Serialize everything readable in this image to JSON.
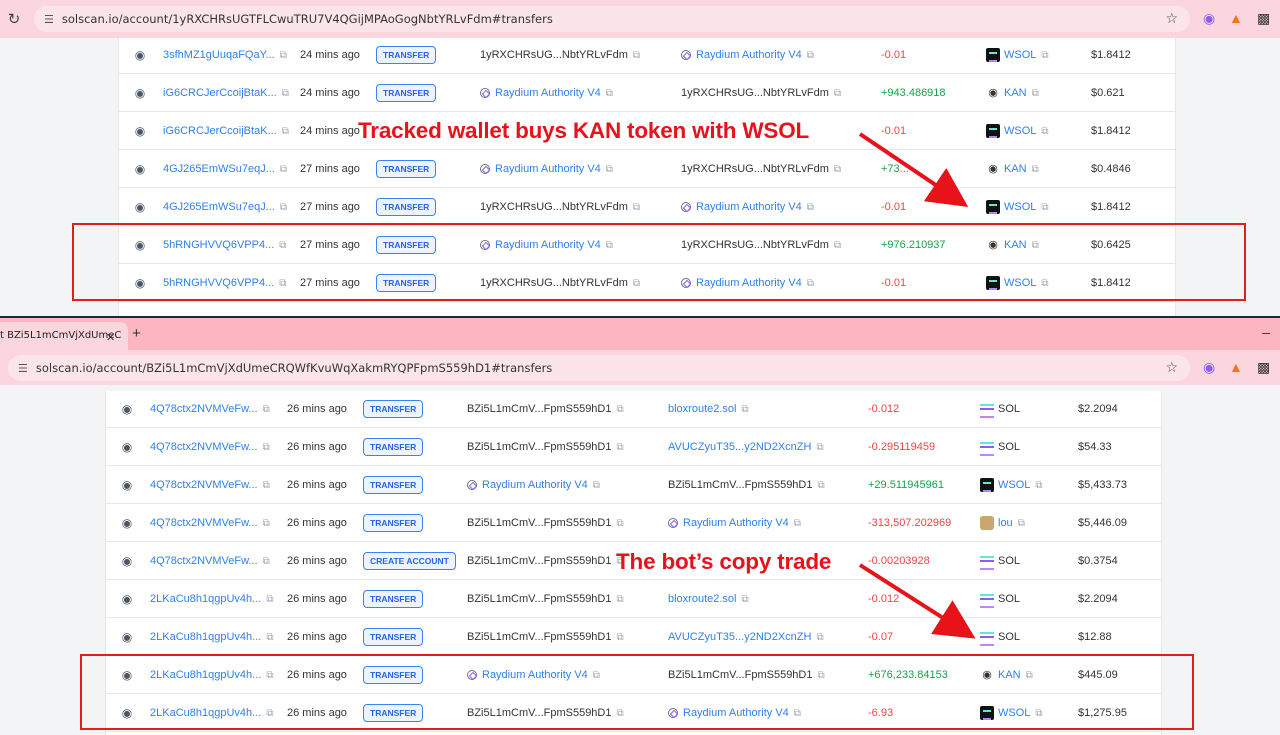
{
  "top_window": {
    "url": "solscan.io/account/1yRXCHRsUGTFLCwuTRU7V4QGijMPAoGogNbtYRLvFdm#transfers",
    "rows": [
      {
        "sig": "3sfhMZ1gUuqaFQaY...",
        "time": "24 mins ago",
        "action": "TRANSFER",
        "from": "1yRXCHRsUG...NbtYRLvFdm",
        "from_link": false,
        "from_ray": false,
        "to": "Raydium Authority V4",
        "to_link": true,
        "to_ray": true,
        "amount": "-0.01",
        "sign": "neg",
        "token": "WSOL",
        "token_icon": "wsol",
        "value": "$1.8412"
      },
      {
        "sig": "iG6CRCJerCcoijBtaK...",
        "time": "24 mins ago",
        "action": "TRANSFER",
        "from": "Raydium Authority V4",
        "from_link": true,
        "from_ray": true,
        "to": "1yRXCHRsUG...NbtYRLvFdm",
        "to_link": false,
        "to_ray": false,
        "amount": "+943.486918",
        "sign": "pos",
        "token": "KAN",
        "token_icon": "kan",
        "value": "$0.621"
      },
      {
        "sig": "iG6CRCJerCcoijBtaK...",
        "time": "24 mins ago",
        "action": "",
        "from": "",
        "from_link": false,
        "from_ray": false,
        "to": "",
        "to_link": false,
        "to_ray": false,
        "amount": "-0.01",
        "sign": "neg",
        "token": "WSOL",
        "token_icon": "wsol",
        "value": "$1.8412"
      },
      {
        "sig": "4GJ265EmWSu7eqJ...",
        "time": "27 mins ago",
        "action": "TRANSFER",
        "from": "Raydium Authority V4",
        "from_link": true,
        "from_ray": true,
        "to": "1yRXCHRsUG...NbtYRLvFdm",
        "to_link": false,
        "to_ray": false,
        "amount": "+73...",
        "sign": "pos",
        "token": "KAN",
        "token_icon": "kan",
        "value": "$0.4846"
      },
      {
        "sig": "4GJ265EmWSu7eqJ...",
        "time": "27 mins ago",
        "action": "TRANSFER",
        "from": "1yRXCHRsUG...NbtYRLvFdm",
        "from_link": false,
        "from_ray": false,
        "to": "Raydium Authority V4",
        "to_link": true,
        "to_ray": true,
        "amount": "-0.01",
        "sign": "neg",
        "token": "WSOL",
        "token_icon": "wsol",
        "value": "$1.8412"
      },
      {
        "sig": "5hRNGHVVQ6VPP4...",
        "time": "27 mins ago",
        "action": "TRANSFER",
        "from": "Raydium Authority V4",
        "from_link": true,
        "from_ray": true,
        "to": "1yRXCHRsUG...NbtYRLvFdm",
        "to_link": false,
        "to_ray": false,
        "amount": "+976.210937",
        "sign": "pos",
        "token": "KAN",
        "token_icon": "kan",
        "value": "$0.6425"
      },
      {
        "sig": "5hRNGHVVQ6VPP4...",
        "time": "27 mins ago",
        "action": "TRANSFER",
        "from": "1yRXCHRsUG...NbtYRLvFdm",
        "from_link": false,
        "from_ray": false,
        "to": "Raydium Authority V4",
        "to_link": true,
        "to_ray": true,
        "amount": "-0.01",
        "sign": "neg",
        "token": "WSOL",
        "token_icon": "wsol",
        "value": "$1.8412"
      }
    ],
    "annotation": "Tracked wallet buys KAN token with WSOL"
  },
  "bottom_window": {
    "tab_title": "t BZi5L1mCmVjXdUmeC",
    "url": "solscan.io/account/BZi5L1mCmVjXdUmeCRQWfKvuWqXakmRYQPFpmS559hD1#transfers",
    "rows": [
      {
        "sig": "4Q78ctx2NVMVeFw...",
        "time": "26 mins ago",
        "action": "TRANSFER",
        "from": "BZi5L1mCmV...FpmS559hD1",
        "from_link": false,
        "from_ray": false,
        "to": "bloxroute2.sol",
        "to_link": true,
        "to_ray": false,
        "amount": "-0.012",
        "sign": "neg",
        "token": "SOL",
        "token_icon": "sol",
        "value": "$2.2094"
      },
      {
        "sig": "4Q78ctx2NVMVeFw...",
        "time": "26 mins ago",
        "action": "TRANSFER",
        "from": "BZi5L1mCmV...FpmS559hD1",
        "from_link": false,
        "from_ray": false,
        "to": "AVUCZyuT35...y2ND2XcnZH",
        "to_link": true,
        "to_ray": false,
        "amount": "-0.295119459",
        "sign": "neg",
        "token": "SOL",
        "token_icon": "sol",
        "value": "$54.33"
      },
      {
        "sig": "4Q78ctx2NVMVeFw...",
        "time": "26 mins ago",
        "action": "TRANSFER",
        "from": "Raydium Authority V4",
        "from_link": true,
        "from_ray": true,
        "to": "BZi5L1mCmV...FpmS559hD1",
        "to_link": false,
        "to_ray": false,
        "amount": "+29.511945961",
        "sign": "pos",
        "token": "WSOL",
        "token_icon": "wsol",
        "value": "$5,433.73"
      },
      {
        "sig": "4Q78ctx2NVMVeFw...",
        "time": "26 mins ago",
        "action": "TRANSFER",
        "from": "BZi5L1mCmV...FpmS559hD1",
        "from_link": false,
        "from_ray": false,
        "to": "Raydium Authority V4",
        "to_link": true,
        "to_ray": true,
        "amount": "-313,507.202969",
        "sign": "neg",
        "token": "lou",
        "token_icon": "lou",
        "value": "$5,446.09"
      },
      {
        "sig": "4Q78ctx2NVMVeFw...",
        "time": "26 mins ago",
        "action": "CREATE ACCOUNT",
        "from": "BZi5L1mCmV...FpmS559hD1",
        "from_link": false,
        "from_ray": false,
        "to": "",
        "to_link": false,
        "to_ray": false,
        "amount": "-0.00203928",
        "sign": "neg",
        "token": "SOL",
        "token_icon": "sol",
        "value": "$0.3754"
      },
      {
        "sig": "2LKaCu8h1qgpUv4h...",
        "time": "26 mins ago",
        "action": "TRANSFER",
        "from": "BZi5L1mCmV...FpmS559hD1",
        "from_link": false,
        "from_ray": false,
        "to": "bloxroute2.sol",
        "to_link": true,
        "to_ray": false,
        "amount": "-0.012",
        "sign": "neg",
        "token": "SOL",
        "token_icon": "sol",
        "value": "$2.2094"
      },
      {
        "sig": "2LKaCu8h1qgpUv4h...",
        "time": "26 mins ago",
        "action": "TRANSFER",
        "from": "BZi5L1mCmV...FpmS559hD1",
        "from_link": false,
        "from_ray": false,
        "to": "AVUCZyuT35...y2ND2XcnZH",
        "to_link": true,
        "to_ray": false,
        "amount": "-0.07",
        "sign": "neg",
        "token": "SOL",
        "token_icon": "sol",
        "value": "$12.88"
      },
      {
        "sig": "2LKaCu8h1qgpUv4h...",
        "time": "26 mins ago",
        "action": "TRANSFER",
        "from": "Raydium Authority V4",
        "from_link": true,
        "from_ray": true,
        "to": "BZi5L1mCmV...FpmS559hD1",
        "to_link": false,
        "to_ray": false,
        "amount": "+676,233.84153",
        "sign": "pos",
        "token": "KAN",
        "token_icon": "kan",
        "value": "$445.09"
      },
      {
        "sig": "2LKaCu8h1qgpUv4h...",
        "time": "26 mins ago",
        "action": "TRANSFER",
        "from": "BZi5L1mCmV...FpmS559hD1",
        "from_link": false,
        "from_ray": false,
        "to": "Raydium Authority V4",
        "to_link": true,
        "to_ray": true,
        "amount": "-6.93",
        "sign": "neg",
        "token": "WSOL",
        "token_icon": "wsol",
        "value": "$1,275.95"
      }
    ],
    "annotation": "The bot’s copy trade"
  },
  "colors": {
    "annotation_red": "#e8121b",
    "positive": "#16a34a",
    "negative": "#ef4444",
    "link": "#2f80ed",
    "tab_strip": "#fbb6c2"
  },
  "icons": {
    "reload": "reload-icon",
    "site_settings": "tune-icon",
    "bookmark": "star-icon",
    "extensions": "puzzle-icon",
    "metamask": "fox-icon",
    "copy": "copy-icon",
    "view": "eye-icon"
  }
}
